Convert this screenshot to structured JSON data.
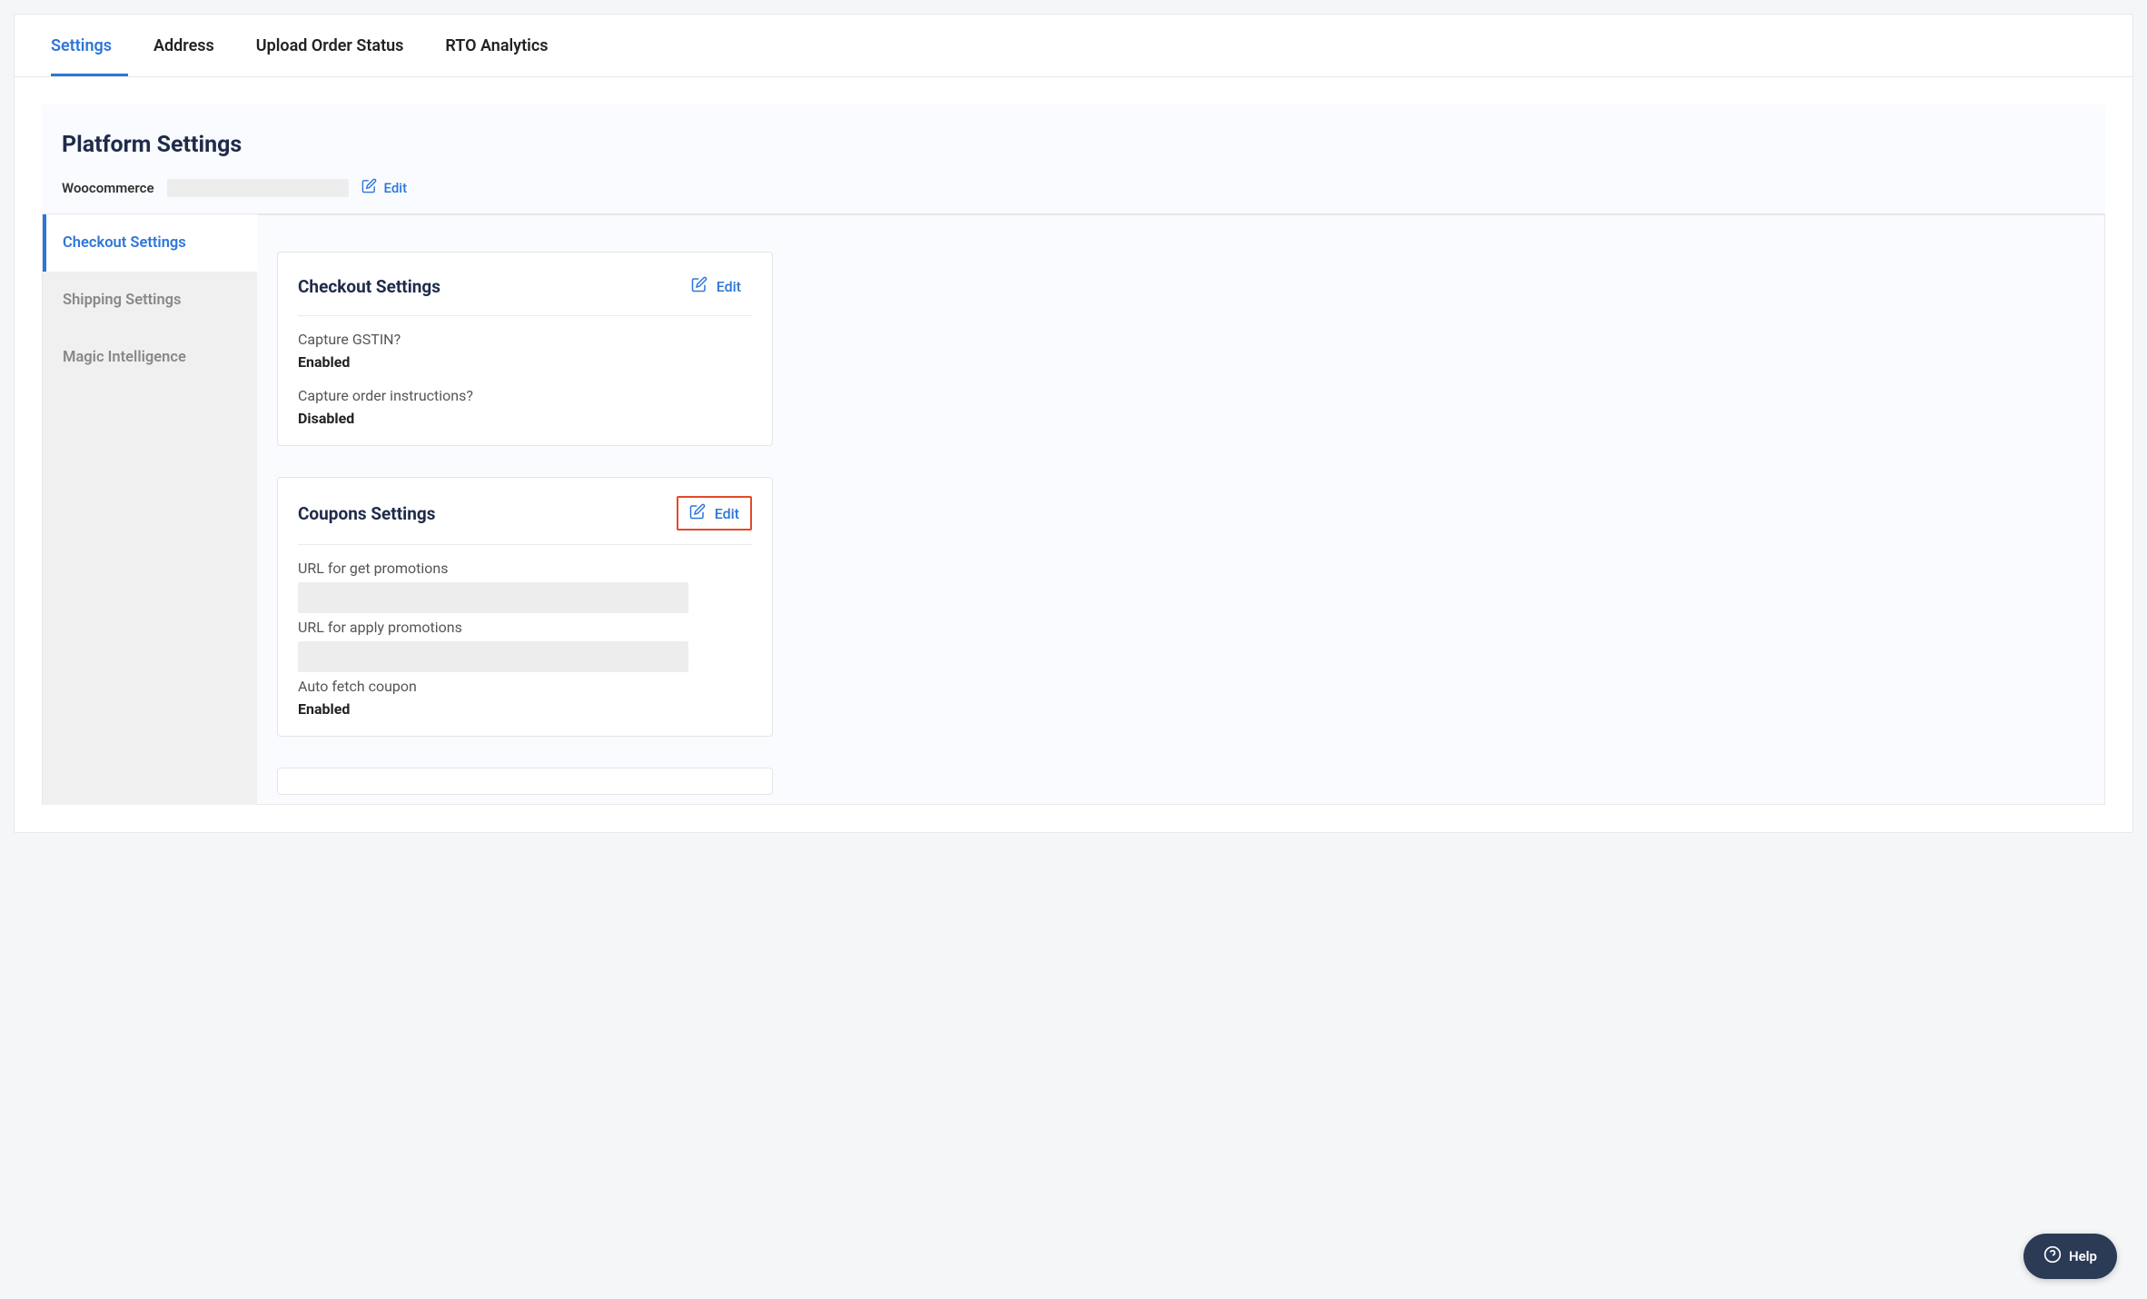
{
  "tabs": {
    "settings": "Settings",
    "address": "Address",
    "upload_order_status": "Upload Order Status",
    "rto_analytics": "RTO Analytics"
  },
  "platform": {
    "title": "Platform Settings",
    "name": "Woocommerce",
    "edit": "Edit"
  },
  "sidenav": {
    "checkout": "Checkout Settings",
    "shipping": "Shipping Settings",
    "magic": "Magic Intelligence"
  },
  "checkout_card": {
    "title": "Checkout Settings",
    "edit": "Edit",
    "capture_gstin_label": "Capture GSTIN?",
    "capture_gstin_value": "Enabled",
    "capture_instructions_label": "Capture order instructions?",
    "capture_instructions_value": "Disabled"
  },
  "coupons_card": {
    "title": "Coupons Settings",
    "edit": "Edit",
    "url_get_label": "URL for get promotions",
    "url_apply_label": "URL for apply promotions",
    "auto_fetch_label": "Auto fetch coupon",
    "auto_fetch_value": "Enabled"
  },
  "help": "Help"
}
